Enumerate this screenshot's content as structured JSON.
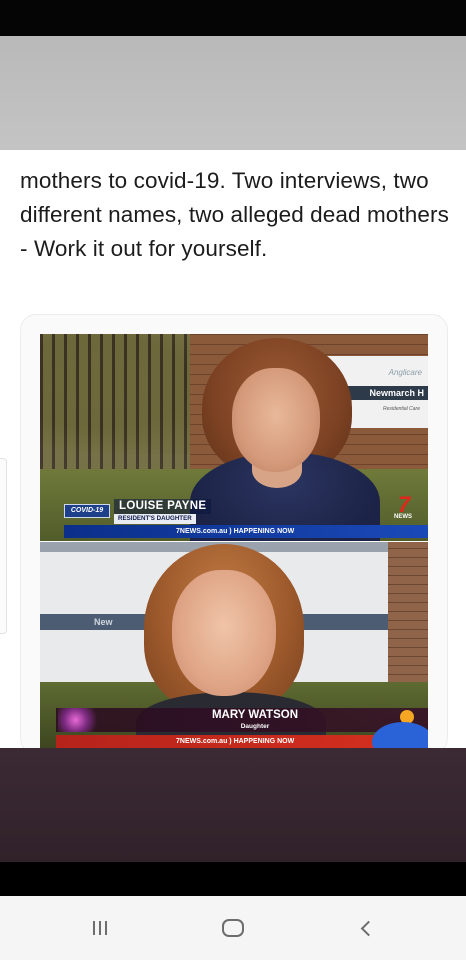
{
  "post": {
    "text": "mothers to covid-19. Two interviews, two different names, two alleged dead mothers - Work it out for yourself."
  },
  "top_clip": {
    "covid_tag": "COVID-19",
    "name": "LOUISE PAYNE",
    "role": "RESIDENT'S DAUGHTER",
    "ticker": "7NEWS.com.au ) HAPPENING NOW",
    "sign_brand": "Anglicare",
    "sign_name": "Newmarch H",
    "sign_sub": "Residential Care",
    "channel_logo": "7",
    "channel_news": "NEWS"
  },
  "bottom_clip": {
    "name": "MARY WATSON",
    "role": "Daughter",
    "ticker": "7NEWS.com.au ) HAPPENING NOW",
    "sign_text": "New"
  },
  "navbar": {
    "recent_icon": "recent-apps-icon",
    "home_icon": "home-icon",
    "back_icon": "back-icon"
  },
  "colors": {
    "top_ticker": "#0b2f8a",
    "bottom_ticker": "#c42a1e",
    "channel_red": "#e1261c"
  }
}
